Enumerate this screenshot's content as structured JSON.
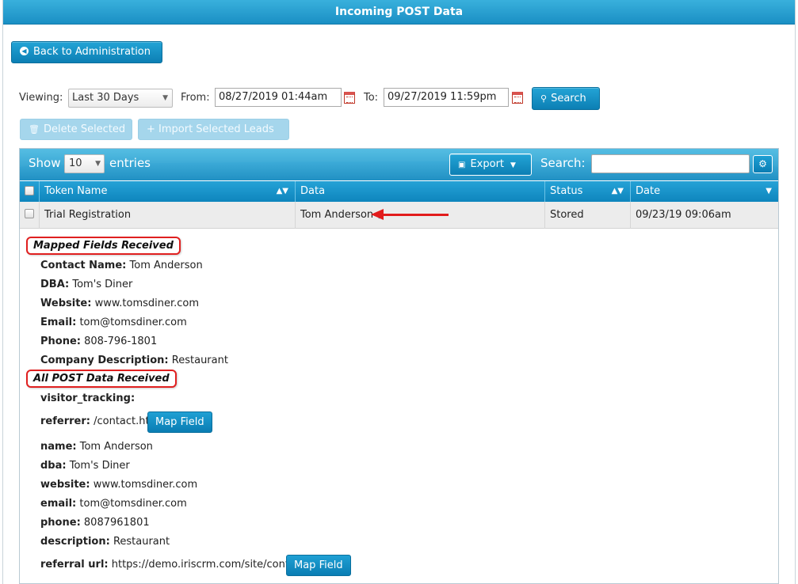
{
  "title": "Incoming POST Data",
  "back_button": "Back to Administration",
  "filters": {
    "viewing_label": "Viewing:",
    "viewing_value": "Last 30 Days",
    "from_label": "From:",
    "from_value": "08/27/2019 01:44am",
    "to_label": "To:",
    "to_value": "09/27/2019 11:59pm",
    "search_button": "Search"
  },
  "actions": {
    "delete_selected": "Delete Selected",
    "import_selected": "+ Import Selected Leads"
  },
  "table_controls": {
    "show_label": "Show",
    "entries_value": "10",
    "entries_label": "entries",
    "export_button": "Export",
    "search_label": "Search:"
  },
  "columns": [
    "Token Name",
    "Data",
    "Status",
    "Date"
  ],
  "row": {
    "token_name": "Trial Registration",
    "data": "Tom Anderson",
    "status": "Stored",
    "date": "09/23/19 09:06am"
  },
  "mapped_section": {
    "heading": "Mapped Fields Received",
    "fields": [
      {
        "label": "Contact Name:",
        "value": "Tom Anderson"
      },
      {
        "label": "DBA:",
        "value": "Tom's Diner"
      },
      {
        "label": "Website:",
        "value": "www.tomsdiner.com"
      },
      {
        "label": "Email:",
        "value": "tom@tomsdiner.com"
      },
      {
        "label": "Phone:",
        "value": "808-796-1801"
      },
      {
        "label": "Company Description:",
        "value": "Restaurant"
      }
    ]
  },
  "post_section": {
    "heading": "All POST Data Received",
    "fields": [
      {
        "label": "visitor_tracking:",
        "value": ""
      },
      {
        "label": "referrer:",
        "value": "/contact.html"
      },
      {
        "label": "name:",
        "value": "Tom Anderson"
      },
      {
        "label": "dba:",
        "value": "Tom's Diner"
      },
      {
        "label": "website:",
        "value": "www.tomsdiner.com"
      },
      {
        "label": "email:",
        "value": "tom@tomsdiner.com"
      },
      {
        "label": "phone:",
        "value": "8087961801"
      },
      {
        "label": "description:",
        "value": "Restaurant"
      },
      {
        "label": "referral url:",
        "value": "https://demo.iriscrm.com/site/contact.html"
      }
    ],
    "map_field_button": "Map Field"
  },
  "colors": {
    "accent": "#1a8fc4",
    "annotation": "#e21c1c"
  }
}
